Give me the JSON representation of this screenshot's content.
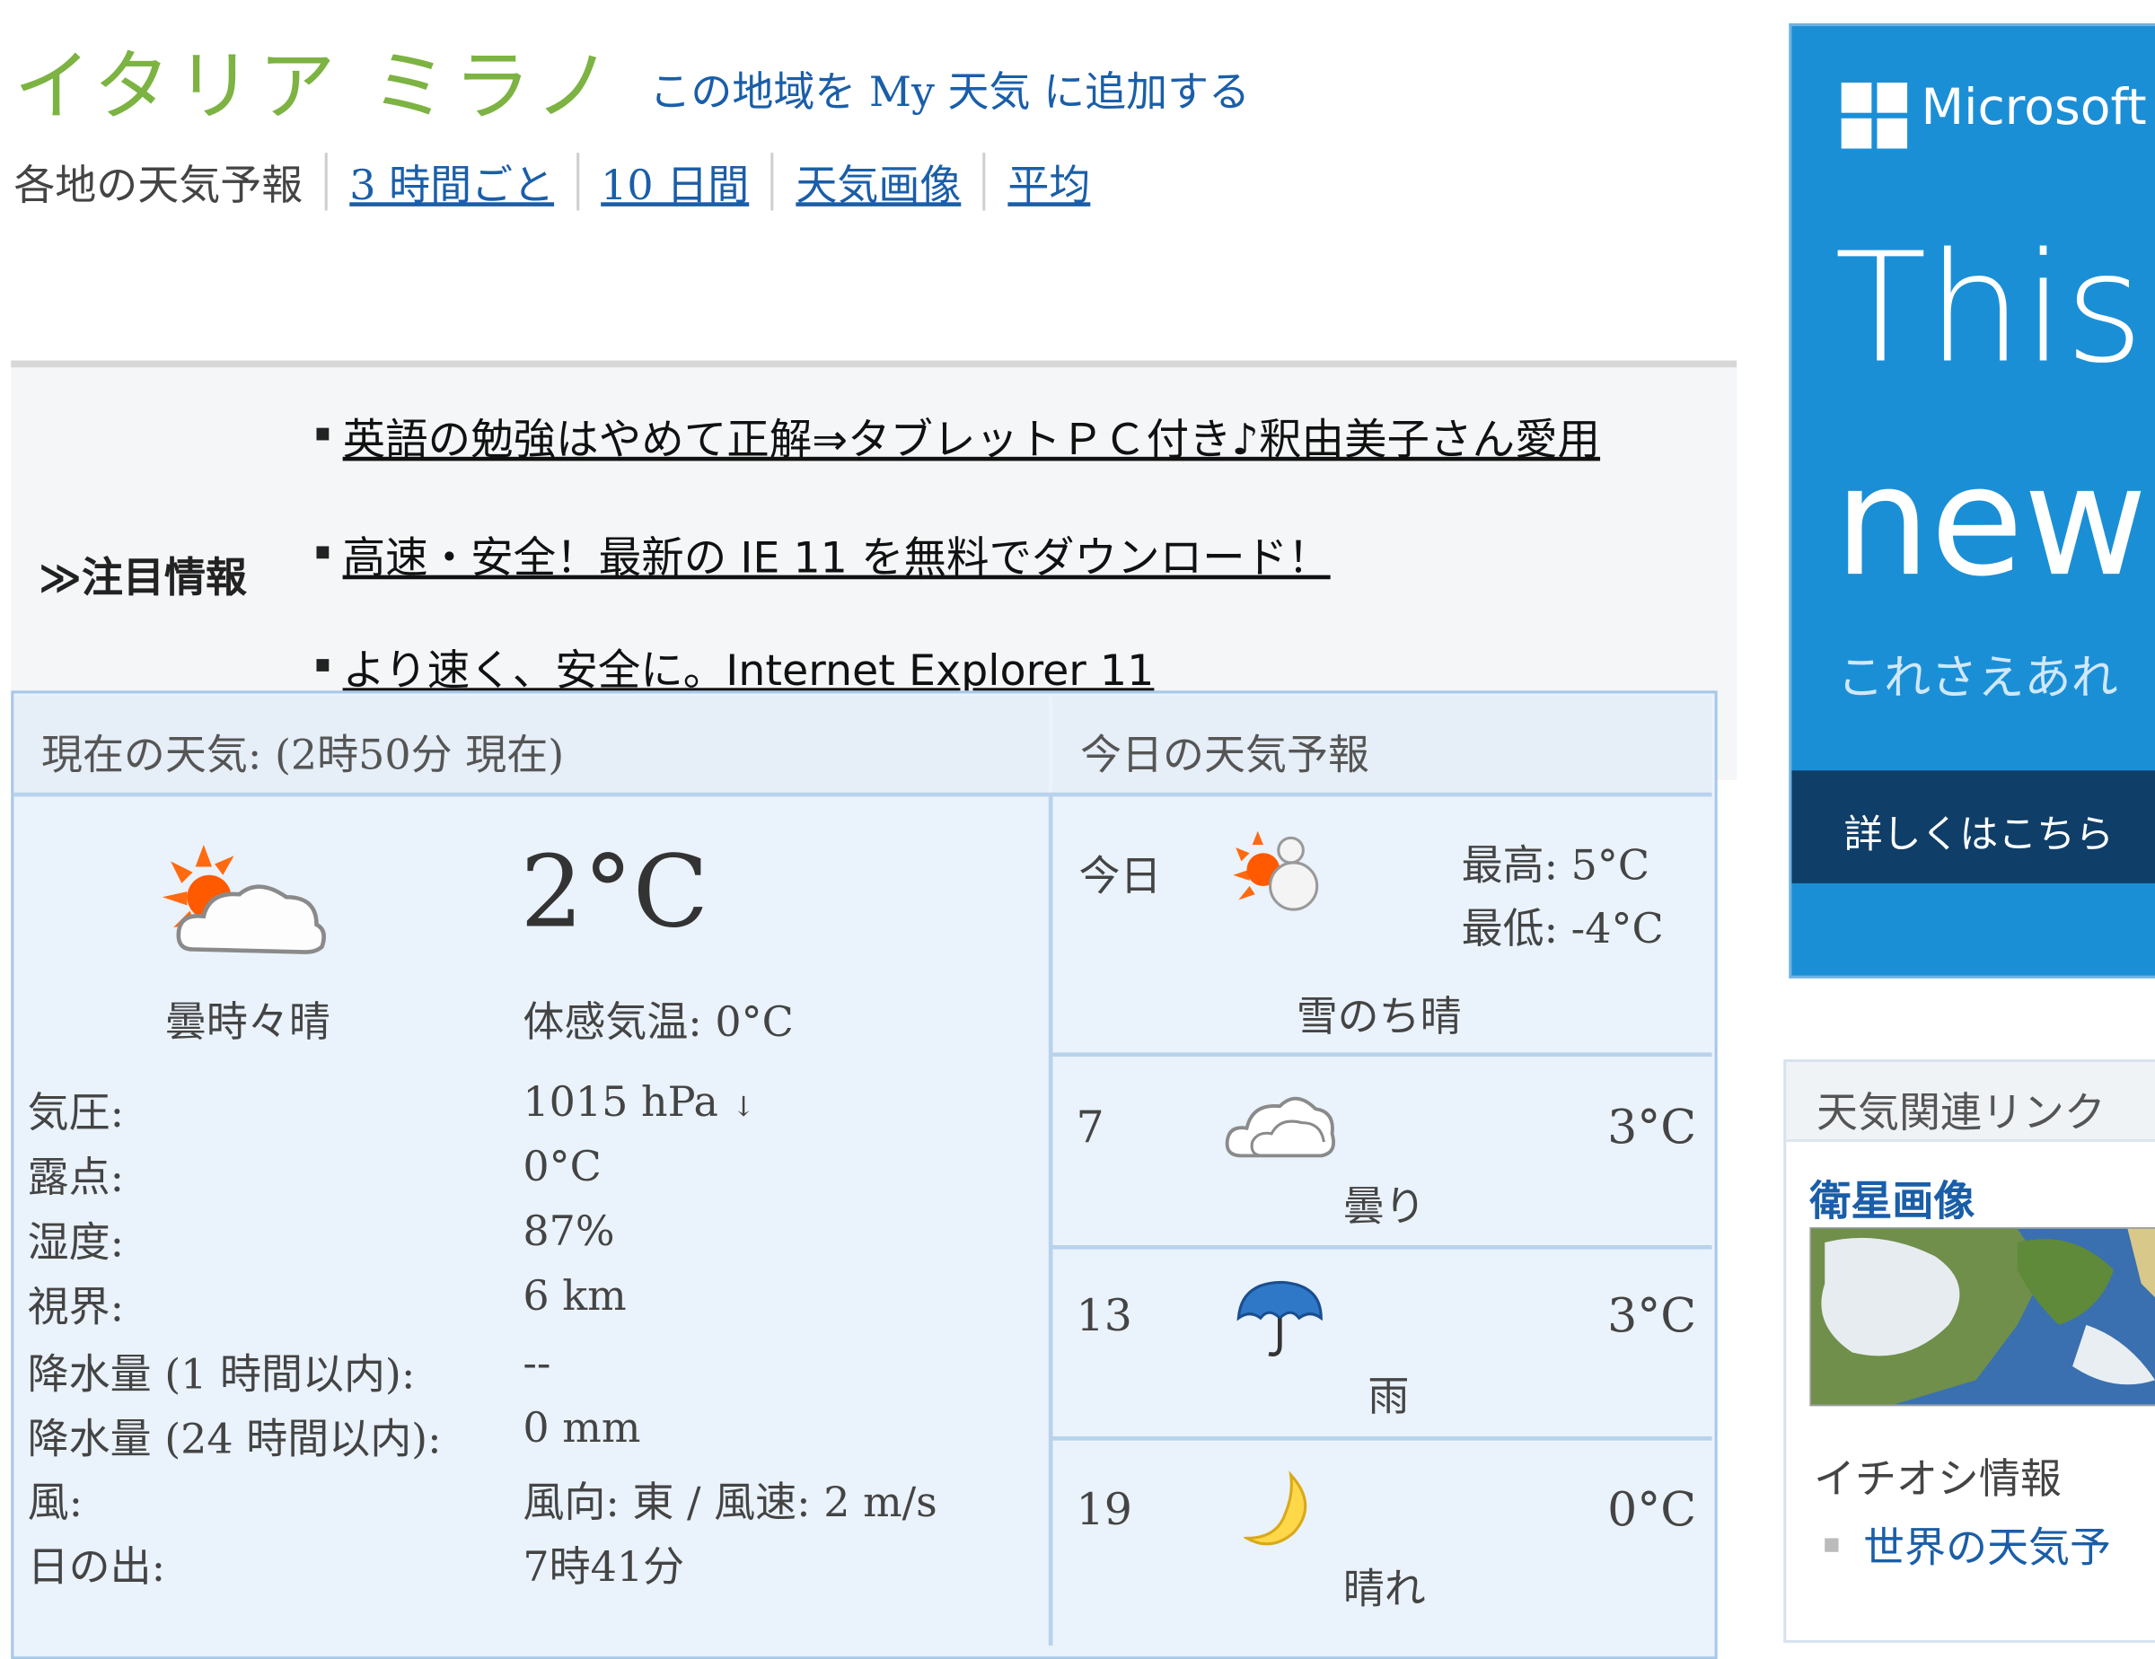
{
  "header": {
    "city": "イタリア ミラノ",
    "add_my": "この地域を My 天気 に追加する"
  },
  "nav": {
    "label": "各地の天気予報",
    "links": [
      "3 時間ごと",
      "10 日間",
      "天気画像",
      "平均"
    ]
  },
  "pickup": {
    "label": "≫注目情報",
    "items": [
      "英語の勉強はやめて正解⇒タブレットＰＣ付き♪釈由美子さん愛用",
      "高速・安全！最新の IE 11 を無料でダウンロード！",
      "より速く、安全に。Internet Explorer 11"
    ]
  },
  "current": {
    "header": "現在の天気: (2時50分 現在)",
    "temp": "2°C",
    "condition": "曇時々晴",
    "feels_like": "体感気温: 0°C",
    "icon": "sun-cloud-icon",
    "rows": [
      {
        "label": "気圧:",
        "value": "1015 hPa"
      },
      {
        "label": "露点:",
        "value": "0°C"
      },
      {
        "label": "湿度:",
        "value": "87%"
      },
      {
        "label": "視界:",
        "value": "6 km"
      },
      {
        "label": "降水量 (1 時間以内):",
        "value": "--"
      },
      {
        "label": "降水量 (24 時間以内):",
        "value": "0 mm"
      },
      {
        "label": "風:",
        "value": "風向: 東 / 風速: 2 m/s"
      },
      {
        "label": "日の出:",
        "value": "7時41分"
      }
    ],
    "pressure_trend": "down-arrow-icon"
  },
  "forecast": {
    "header": "今日の天気予報",
    "today": {
      "day": "今日",
      "high": "最高: 5°C",
      "low": "最低: -4°C",
      "condition": "雪のち晴",
      "icon": "snowman-sun-icon"
    },
    "hours": [
      {
        "hour": "7",
        "temp": "3°C",
        "condition": "曇り",
        "icon": "cloud-icon"
      },
      {
        "hour": "13",
        "temp": "3°C",
        "condition": "雨",
        "icon": "umbrella-icon"
      },
      {
        "hour": "19",
        "temp": "0°C",
        "condition": "晴れ",
        "icon": "moon-icon"
      }
    ]
  },
  "ad": {
    "brand": "Microsoft",
    "line1": "This",
    "line2": "new",
    "sub": "これさえあれ",
    "cta": "詳しくはこちら",
    "color": "#1b8fd6"
  },
  "related": {
    "title": "天気関連リンク",
    "satellite": "衛星画像",
    "pick_title": "イチオシ情報",
    "world": "世界の天気予"
  }
}
